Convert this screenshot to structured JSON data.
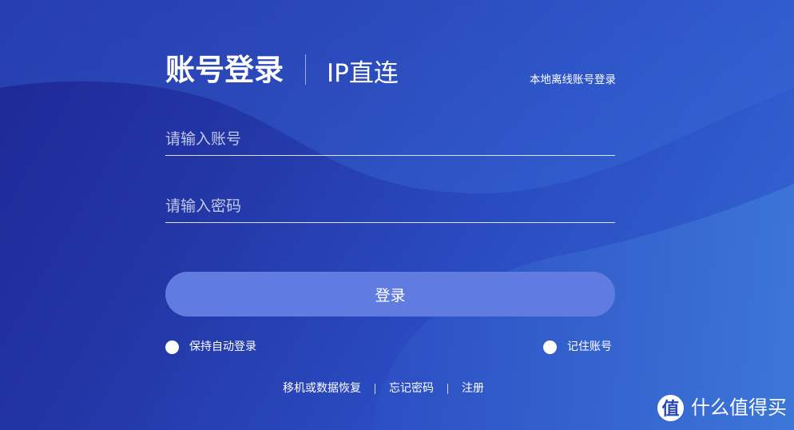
{
  "login": {
    "tabs": {
      "account": "账号登录",
      "ip_direct": "IP直连"
    },
    "offline_login": "本地离线账号登录",
    "account_placeholder": "请输入账号",
    "password_placeholder": "请输入密码",
    "submit_label": "登录",
    "auto_login_label": "保持自动登录",
    "remember_label": "记住账号",
    "links": {
      "migrate": "移机或数据恢复",
      "forgot": "忘记密码",
      "register": "注册"
    }
  },
  "watermark": {
    "logo_glyph": "值",
    "text": "什么值得买"
  },
  "colors": {
    "bg_dark": "#1d2795",
    "bg_light": "#3469d6",
    "button": "#617ce1"
  },
  "icons": [
    "radio-button-icon",
    "smzdm-logo-icon"
  ]
}
